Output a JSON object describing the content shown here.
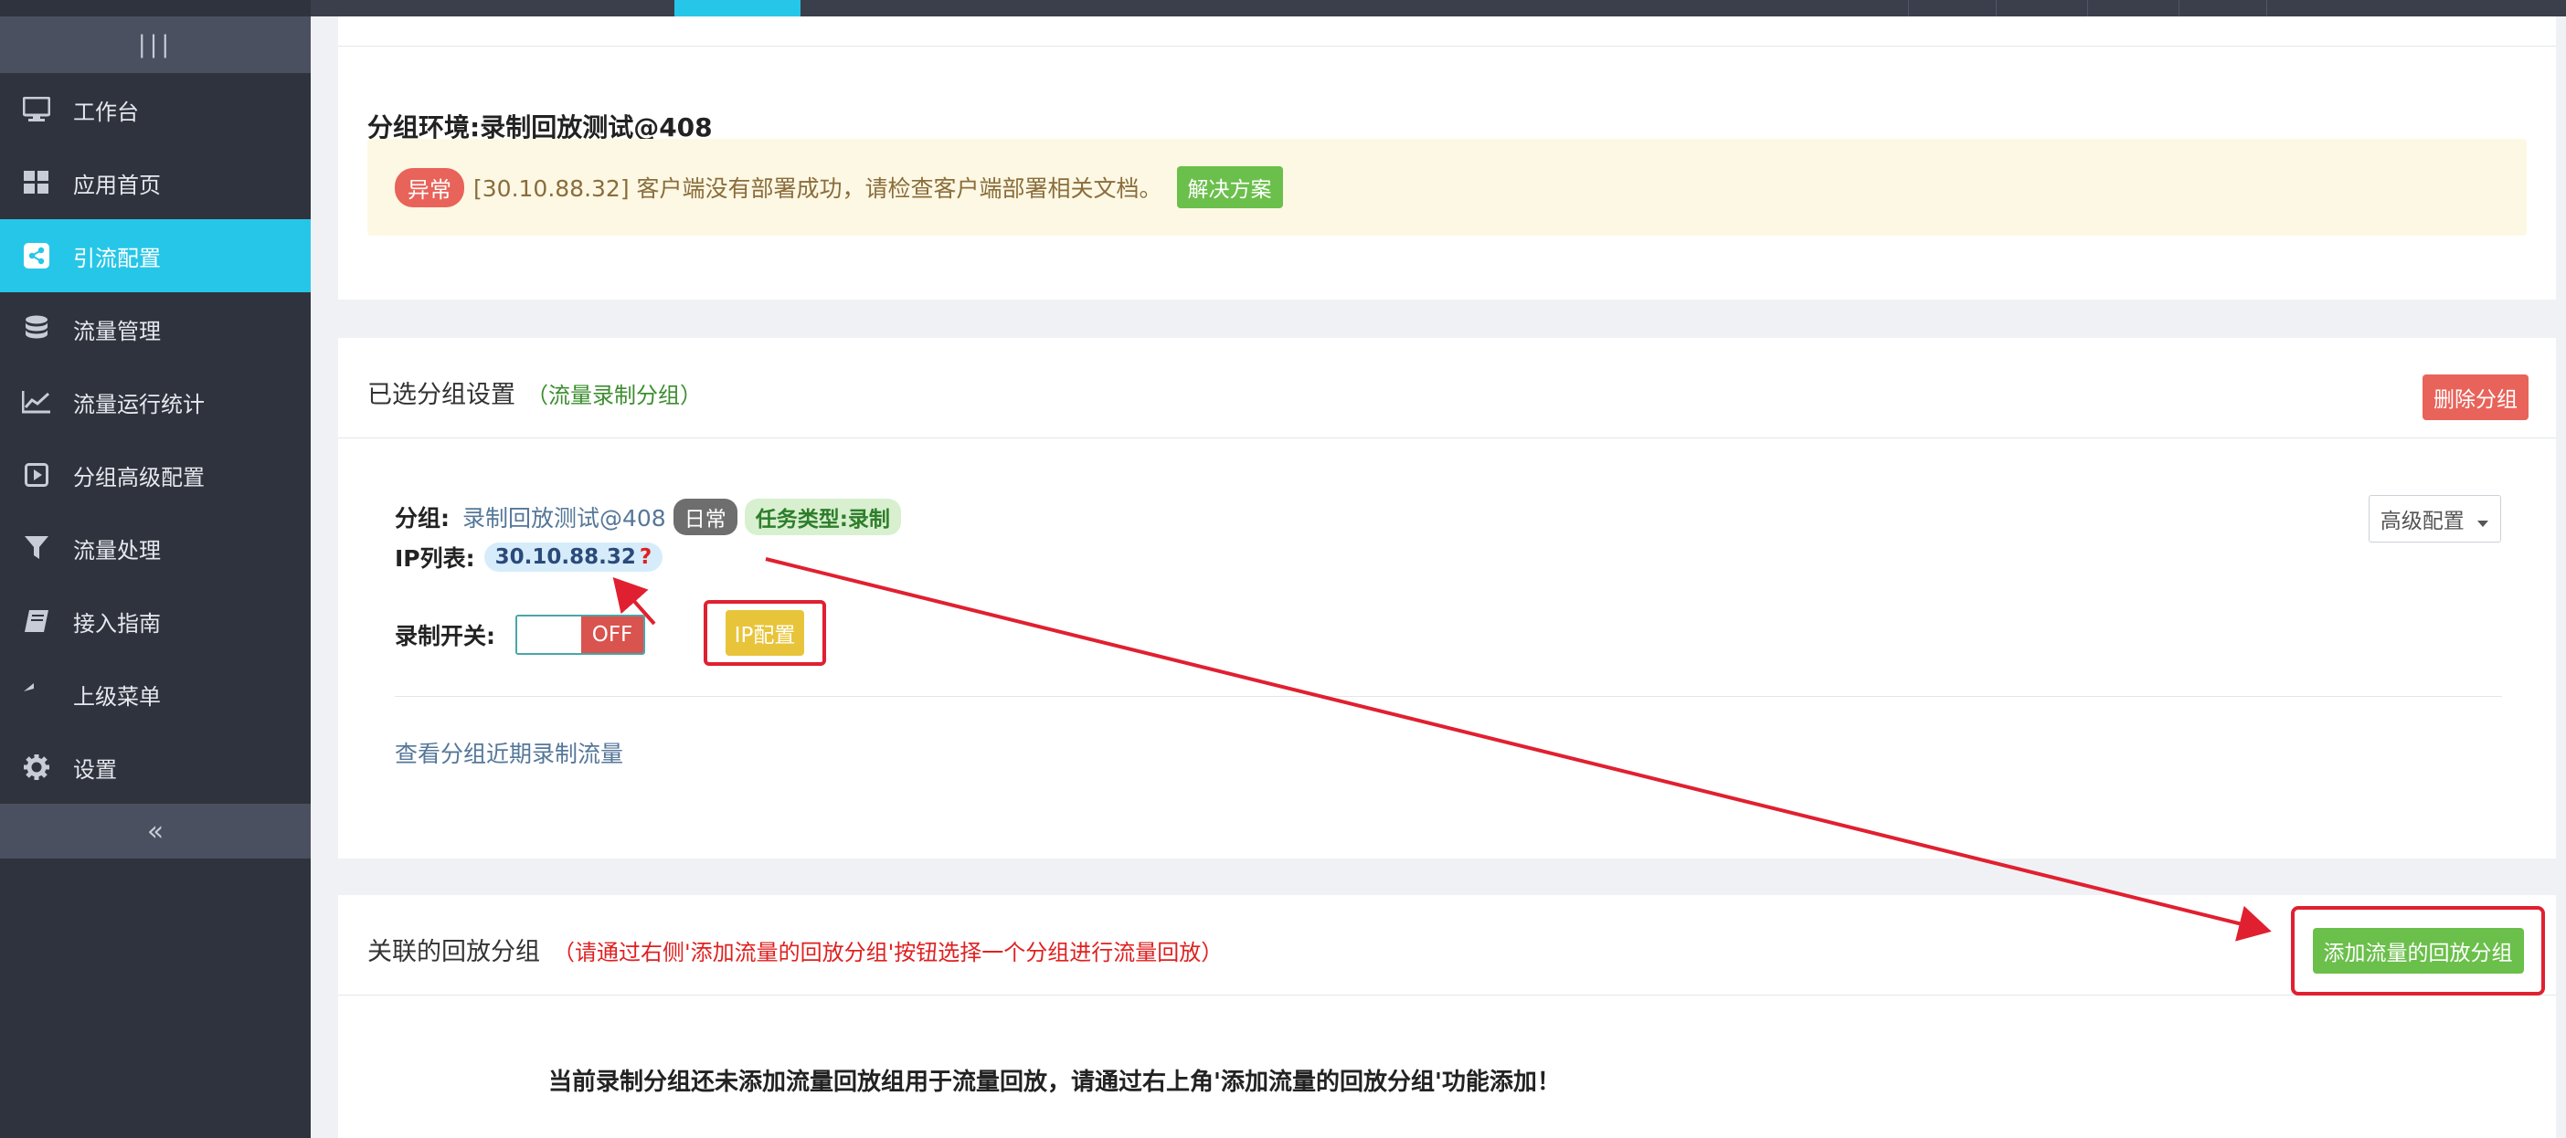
{
  "sidebar": {
    "toggle_glyph": "|||",
    "collapse_glyph": "«",
    "items": [
      {
        "label": "工作台",
        "icon": "monitor-icon"
      },
      {
        "label": "应用首页",
        "icon": "grid-icon"
      },
      {
        "label": "引流配置",
        "icon": "share-icon",
        "active": true
      },
      {
        "label": "流量管理",
        "icon": "database-icon"
      },
      {
        "label": "流量运行统计",
        "icon": "line-chart-icon"
      },
      {
        "label": "分组高级配置",
        "icon": "play-square-icon"
      },
      {
        "label": "流量处理",
        "icon": "filter-icon"
      },
      {
        "label": "接入指南",
        "icon": "book-icon"
      },
      {
        "label": "上级菜单",
        "icon": "reply-icon"
      },
      {
        "label": "设置",
        "icon": "gear-icon"
      }
    ]
  },
  "env_panel": {
    "title": "分组环境:录制回放测试@408",
    "alert": {
      "badge": "异常",
      "message": "[30.10.88.32] 客户端没有部署成功，请检查客户端部署相关文档。",
      "solution_button": "解决方案"
    }
  },
  "group_panel": {
    "title": "已选分组设置",
    "subtitle": "（流量录制分组）",
    "delete_button": "删除分组",
    "group_label": "分组:",
    "group_name": "录制回放测试@408",
    "env_tag": "日常",
    "task_tag": "任务类型:录制",
    "ip_label": "IP列表:",
    "ip": "30.10.88.32",
    "ip_help": "?",
    "advanced_button": "高级配置",
    "record_label": "录制开关:",
    "record_state": "OFF",
    "ip_config_button": "IP配置",
    "recent_link": "查看分组近期录制流量"
  },
  "replay_panel": {
    "title": "关联的回放分组",
    "subtitle": "（请通过右侧'添加流量的回放分组'按钮选择一个分组进行流量回放）",
    "add_button": "添加流量的回放分组",
    "empty_message": "当前录制分组还未添加流量回放组用于流量回放，请通过右上角'添加流量的回放分组'功能添加！"
  },
  "colors": {
    "sidebar_bg": "#2f333d",
    "accent": "#26c6e8",
    "annotation_red": "#e02030"
  }
}
